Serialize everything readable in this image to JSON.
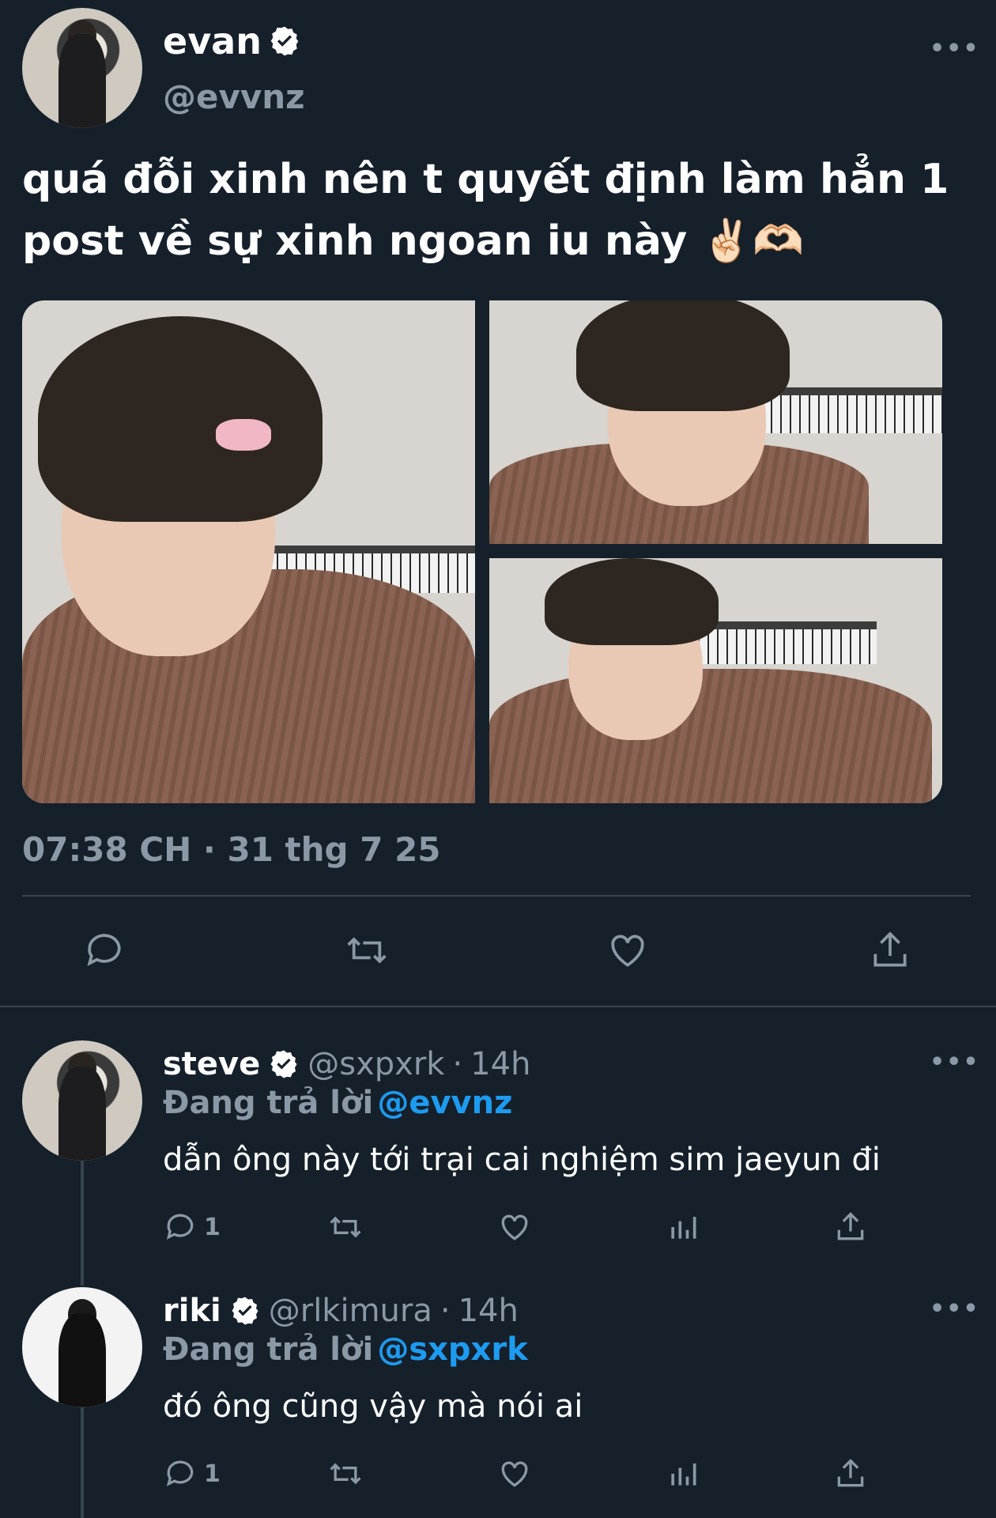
{
  "tweet": {
    "author": {
      "name": "evan",
      "handle": "@evvnz",
      "verified": true
    },
    "text_line1": "quá đỗi xinh nên t quyết định làm hẳn 1",
    "text_line2": "post về sự xinh ngoan iu này ✌🏻🫶🏻",
    "timestamp": "07:38 CH · 31 thg 7 25",
    "more_label": "•••",
    "icons": [
      "reply-icon",
      "retweet-icon",
      "like-icon",
      "share-icon"
    ]
  },
  "replies": [
    {
      "name": "steve",
      "handle": "@sxpxrk",
      "sep": "·",
      "time": "14h",
      "verified": true,
      "replying_label": "Đang trả lời",
      "replying_to": "@evvnz",
      "text": "dẫn ông này tới trại cai nghiệm sim jaeyun đi",
      "reply_count": "1",
      "more_label": "•••"
    },
    {
      "name": "riki",
      "handle": "@rlkimura",
      "sep": "·",
      "time": "14h",
      "verified": true,
      "replying_label": "Đang trả lời",
      "replying_to": "@sxpxrk",
      "text": "đó ông cũng vậy mà nói ai",
      "reply_count": "1",
      "more_label": "•••"
    }
  ],
  "colors": {
    "background": "#15202b",
    "accent": "#1d9bf0",
    "muted": "#8b98a5",
    "divider": "#38444d"
  }
}
